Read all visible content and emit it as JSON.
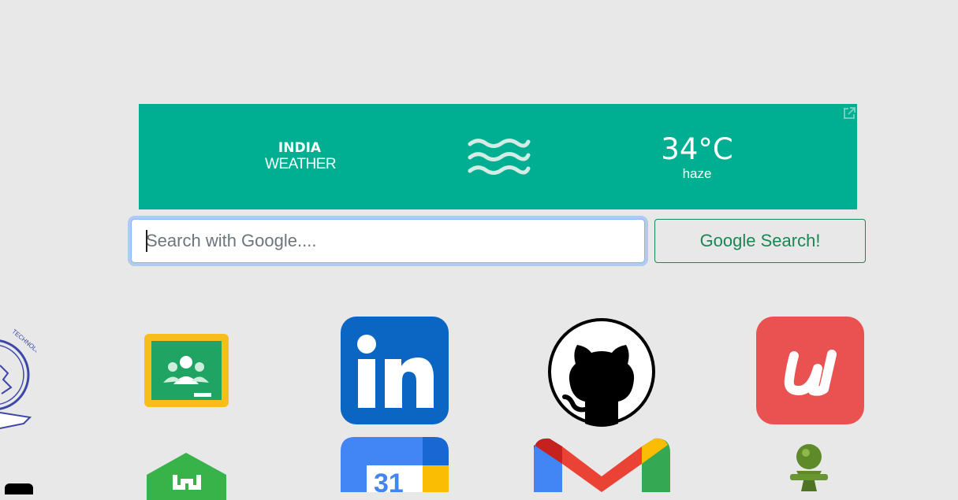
{
  "weather": {
    "country": "INDIA",
    "label": "WEATHER",
    "temperature": "34°C",
    "condition": "haze",
    "icon": "haze-icon"
  },
  "search": {
    "placeholder": "Search with Google....",
    "button_label": "Google Search!"
  },
  "shortcuts": [
    {
      "name": "institute-logo",
      "icon": "institute-emblem-icon"
    },
    {
      "name": "google-classroom",
      "icon": "google-classroom-icon"
    },
    {
      "name": "linkedin",
      "icon": "linkedin-icon"
    },
    {
      "name": "github",
      "icon": "github-icon"
    },
    {
      "name": "udemy",
      "icon": "udemy-icon"
    },
    {
      "name": "upwork",
      "icon": "upwork-icon"
    },
    {
      "name": "google-calendar",
      "icon": "google-calendar-icon"
    },
    {
      "name": "gmail",
      "icon": "gmail-icon"
    },
    {
      "name": "chess",
      "icon": "chess-pawn-icon"
    }
  ],
  "colors": {
    "background": "#e8e8e8",
    "weather_bg": "#00af91",
    "button_green": "#198754",
    "focus_ring": "#86b7fe"
  },
  "institute_logo_text": "TECHNOLOGY",
  "calendar_day": "31"
}
